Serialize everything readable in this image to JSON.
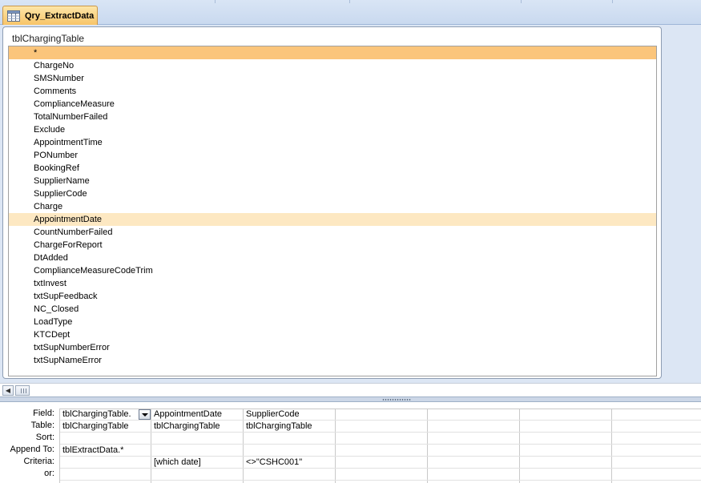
{
  "window": {
    "tab_label": "Qry_ExtractData",
    "tab_icon": "query-icon"
  },
  "table": {
    "title": "tblChargingTable",
    "fields": [
      "*",
      "ChargeNo",
      "SMSNumber",
      "Comments",
      "ComplianceMeasure",
      "TotalNumberFailed",
      "Exclude",
      "AppointmentTime",
      "PONumber",
      "BookingRef",
      "SupplierName",
      "SupplierCode",
      "Charge",
      "AppointmentDate",
      "CountNumberFailed",
      "ChargeForReport",
      "DtAdded",
      "ComplianceMeasureCodeTrim",
      "txtInvest",
      "txtSupFeedback",
      "NC_Closed",
      "LoadType",
      "KTCDept",
      "txtSupNumberError",
      "txtSupNameError"
    ],
    "selected_field": "*",
    "highlighted_field": "AppointmentDate"
  },
  "grid": {
    "row_labels": [
      "Field:",
      "Table:",
      "Sort:",
      "Append To:",
      "Criteria:",
      "or:"
    ],
    "columns": [
      {
        "field": "tblChargingTable.",
        "table": "tblChargingTable",
        "sort": "",
        "append_to": "tblExtractData.*",
        "criteria": "",
        "or": "",
        "has_dropdown": true
      },
      {
        "field": "AppointmentDate",
        "table": "tblChargingTable",
        "sort": "",
        "append_to": "",
        "criteria": "[which date]",
        "or": ""
      },
      {
        "field": "SupplierCode",
        "table": "tblChargingTable",
        "sort": "",
        "append_to": "",
        "criteria": "<>\"CSHC001\"",
        "or": ""
      },
      {
        "field": "",
        "table": "",
        "sort": "",
        "append_to": "",
        "criteria": "",
        "or": ""
      },
      {
        "field": "",
        "table": "",
        "sort": "",
        "append_to": "",
        "criteria": "",
        "or": ""
      },
      {
        "field": "",
        "table": "",
        "sort": "",
        "append_to": "",
        "criteria": "",
        "or": ""
      },
      {
        "field": "",
        "table": "",
        "sort": "",
        "append_to": "",
        "criteria": "",
        "or": ""
      }
    ]
  },
  "colors": {
    "selected_row": "#fbc57b",
    "hover_row": "#fde8c2",
    "tab_bg": "#f7c468",
    "workspace_bg": "#dce6f4"
  }
}
